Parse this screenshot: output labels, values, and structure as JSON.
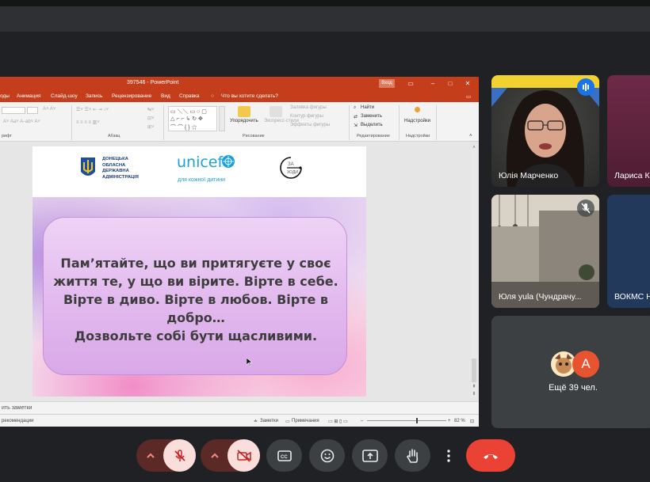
{
  "ppt": {
    "doc_title": "397546 - PowerPoint",
    "signin_label": "Вход",
    "menu": [
      "оды",
      "Анимация",
      "Слайд-шоу",
      "Запись",
      "Рецензирование",
      "Вид",
      "Справка"
    ],
    "tell_me": "Что вы хотите сделать?",
    "ribbon": {
      "arrange_label": "Упорядочить",
      "express_label": "Экспресс-стили",
      "fill_label": "Заливка фигуры",
      "outline_label": "Контур фигуры",
      "effects_label": "Эффекты фигуры",
      "find_label": "Найти",
      "replace_label": "Заменить",
      "select_label": "Выделить",
      "addins_label": "Надстройки",
      "group_font": "рифт",
      "group_paragraph": "Абзац",
      "group_drawing": "Рисование",
      "group_editing": "Редактирование",
      "group_addins": "Надстройки"
    },
    "slide": {
      "org_lines": [
        "ДОНЕЦЬКА",
        "ОБЛАСНА",
        "ДЕРЖАВНА",
        "АДМІНІСТРАЦІЯ"
      ],
      "unicef_text": "unicef",
      "unicef_sub": "для кожної дитини",
      "logo3_text": "ЗА ХОДИ",
      "body_lines": [
        "Пам’ятайте, що ви притягуєте у своє",
        "життя те, у що ви вірите. Вірте в себе.",
        "Вірте в диво. Вірте в любов. Вірте в",
        "добро…",
        "Дозвольте собі бути щасливими."
      ]
    },
    "notes_placeholder": "ить заметки",
    "status_left": "рекомендации",
    "status_notes": "Заметки",
    "status_comments": "Примечания",
    "zoom": "82 %"
  },
  "participants": [
    {
      "name": "Юлія Марченко"
    },
    {
      "name": "Лариса К"
    },
    {
      "name": "Юля yula (Чундрачу..."
    },
    {
      "name": "ВОКМС Н"
    }
  ],
  "others": {
    "avatar_letter": "А",
    "label": "Ещё 39 чел."
  },
  "colors": {
    "ppt_red": "#c43e1c",
    "meet_bg": "#202124",
    "hangup": "#ea4335",
    "mic_off": "#f9dedc"
  }
}
